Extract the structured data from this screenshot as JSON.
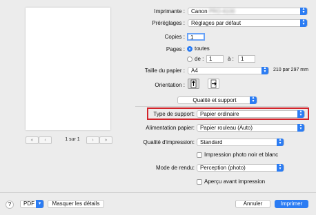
{
  "preview": {
    "page_label": "1 sur 1",
    "first": "«",
    "prev": "‹",
    "next": "›",
    "last": "»"
  },
  "printer": {
    "label": "Imprimante :",
    "value_prefix": "Canon",
    "value_blurred": "PRO-6100"
  },
  "presets": {
    "label": "Préréglages :",
    "value": "Réglages par défaut"
  },
  "copies": {
    "label": "Copies :",
    "value": "1"
  },
  "pages": {
    "label": "Pages :",
    "all_label": "toutes",
    "from_label": "de :",
    "from_value": "1",
    "to_label": "à :",
    "to_value": "1"
  },
  "paper_size": {
    "label": "Taille du papier :",
    "value": "A4",
    "dimensions": "210 par 297 mm"
  },
  "orientation": {
    "label": "Orientation :"
  },
  "section": {
    "value": "Qualité et support"
  },
  "media_type": {
    "label": "Type de support:",
    "value": "Papier ordinaire"
  },
  "paper_source": {
    "label": "Alimentation papier:",
    "value": "Papier rouleau (Auto)"
  },
  "print_quality": {
    "label": "Qualité d'impression:",
    "value": "Standard"
  },
  "grayscale": {
    "label": "Impression photo noir et blanc"
  },
  "rendering": {
    "label": "Mode de rendu:",
    "value": "Perception (photo)"
  },
  "preview_check": {
    "label": "Aperçu avant impression"
  },
  "footer": {
    "help": "?",
    "pdf": "PDF",
    "hide_details": "Masquer les détails",
    "cancel": "Annuler",
    "print": "Imprimer"
  },
  "colors": {
    "accent": "#2b7cf3",
    "highlight": "#d2232a"
  }
}
